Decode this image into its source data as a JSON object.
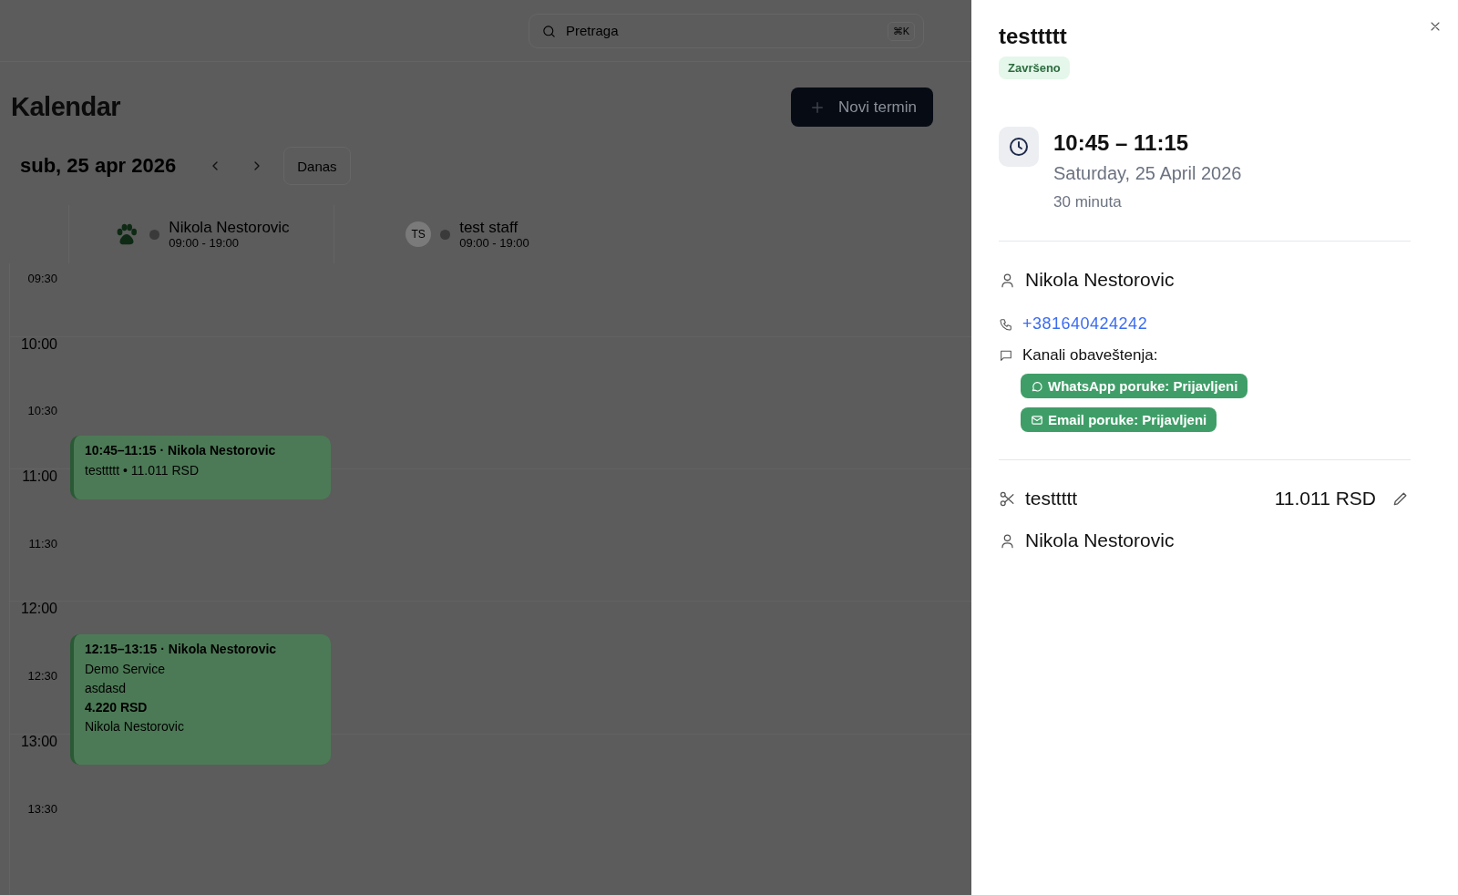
{
  "search": {
    "placeholder": "Pretraga",
    "shortcut": "⌘K"
  },
  "page_title": "Kalendar",
  "new_button": "Novi termin",
  "date_nav": {
    "date": "sub, 25 apr 2026",
    "today_button": "Danas"
  },
  "staff": [
    {
      "name": "Nikola Nestorovic",
      "hours": "09:00 - 19:00",
      "avatar": {
        "kind": "paw"
      }
    },
    {
      "name": "test staff",
      "hours": "09:00 - 19:00",
      "avatar": {
        "kind": "initials",
        "text": "TS"
      }
    }
  ],
  "time_labels": [
    {
      "text": "09:30",
      "kind": "half"
    },
    {
      "text": "10:00",
      "kind": "hour"
    },
    {
      "text": "10:30",
      "kind": "half"
    },
    {
      "text": "11:00",
      "kind": "hour"
    },
    {
      "text": "11:30",
      "kind": "half"
    },
    {
      "text": "12:00",
      "kind": "hour"
    },
    {
      "text": "12:30",
      "kind": "half"
    },
    {
      "text": "13:00",
      "kind": "hour"
    },
    {
      "text": "13:30",
      "kind": "half"
    }
  ],
  "events": [
    {
      "time": "10:45–11:15",
      "separator": "·",
      "name": "Nikola Nestorovic",
      "lines": [
        {
          "text": "testtttt • 11.011 RSD",
          "bold": false
        }
      ]
    },
    {
      "time": "12:15–13:15",
      "separator": "·",
      "name": "Nikola Nestorovic",
      "lines": [
        {
          "text": "Demo Service",
          "bold": false
        },
        {
          "text": "asdasd",
          "bold": false
        },
        {
          "text": "4.220 RSD",
          "bold": true
        },
        {
          "text": "Nikola Nestorovic",
          "bold": false
        }
      ]
    }
  ],
  "detail": {
    "title": "testtttt",
    "status": "Završeno",
    "time": "10:45 – 11:15",
    "date": "Saturday, 25 April 2026",
    "duration": "30 minuta",
    "customer": "Nikola Nestorovic",
    "phone": "+381640424242",
    "channels_label": "Kanali obaveštenja:",
    "channels": [
      {
        "kind": "whatsapp",
        "text": "WhatsApp poruke: Prijavljeni"
      },
      {
        "kind": "email",
        "text": "Email poruke: Prijavljeni"
      }
    ],
    "service": {
      "name": "testtttt",
      "price": "11.011 RSD"
    },
    "staff": "Nikola Nestorovic"
  }
}
